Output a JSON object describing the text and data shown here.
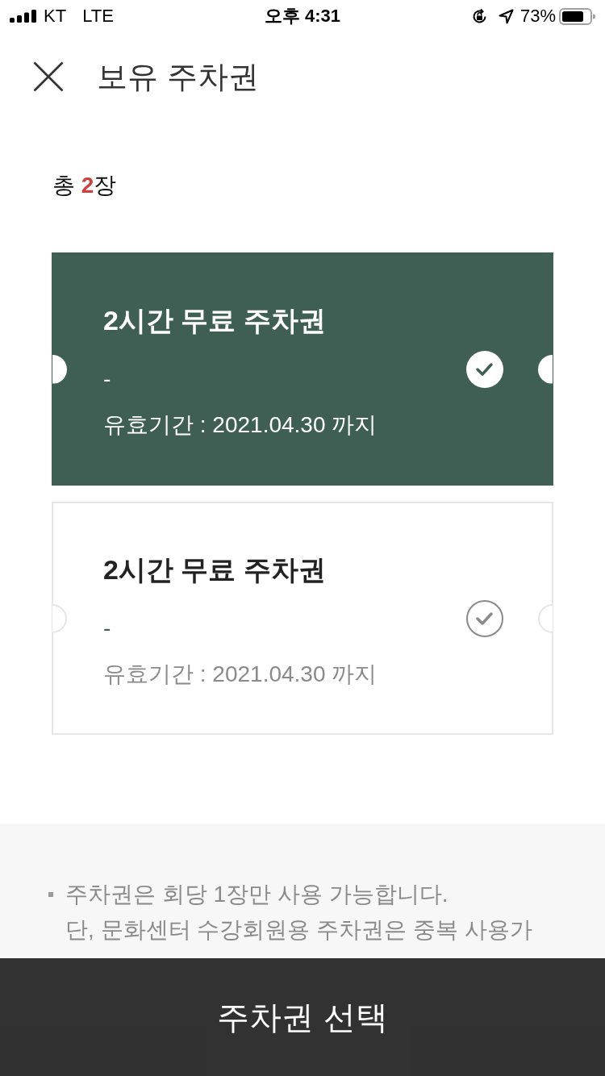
{
  "status_bar": {
    "carrier": "KT",
    "network": "LTE",
    "time": "오후 4:31",
    "battery": "73%"
  },
  "header": {
    "title": "보유 주차권"
  },
  "summary": {
    "label": "총",
    "count": "2",
    "unit": "장"
  },
  "tickets": [
    {
      "title": "2시간 무료 주차권",
      "subtitle": "-",
      "validity": "유효기간 : 2021.04.30 까지",
      "selected": true
    },
    {
      "title": "2시간 무료 주차권",
      "subtitle": "-",
      "validity": "유효기간 : 2021.04.30 까지",
      "selected": false
    }
  ],
  "notes": [
    {
      "lines": [
        "주차권은 회당 1장만 사용 가능합니다.",
        "단, 문화센터 수강회원용 주차권은 중복 사용가"
      ]
    }
  ],
  "bottom_button": {
    "label": "주차권 선택"
  }
}
